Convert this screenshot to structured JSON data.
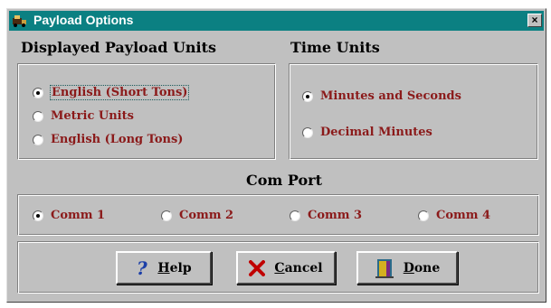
{
  "window": {
    "title": "Payload Options",
    "close_label": "×"
  },
  "payload_units": {
    "heading": "Displayed Payload Units",
    "options": [
      {
        "label": "English (Short Tons)",
        "checked": true
      },
      {
        "label": "Metric Units",
        "checked": false
      },
      {
        "label": "English (Long Tons)",
        "checked": false
      }
    ]
  },
  "time_units": {
    "heading": "Time Units",
    "options": [
      {
        "label": "Minutes and Seconds",
        "checked": true
      },
      {
        "label": "Decimal Minutes",
        "checked": false
      }
    ]
  },
  "com_port": {
    "heading": "Com Port",
    "options": [
      {
        "label": "Comm 1",
        "checked": true
      },
      {
        "label": "Comm 2",
        "checked": false
      },
      {
        "label": "Comm 3",
        "checked": false
      },
      {
        "label": "Comm 4",
        "checked": false
      }
    ]
  },
  "buttons": {
    "help": "Help",
    "cancel": "Cancel",
    "done": "Done"
  },
  "colors": {
    "titlebar": "#0b8082",
    "face": "#c0c0c0",
    "option_text": "#8b1a1a"
  }
}
